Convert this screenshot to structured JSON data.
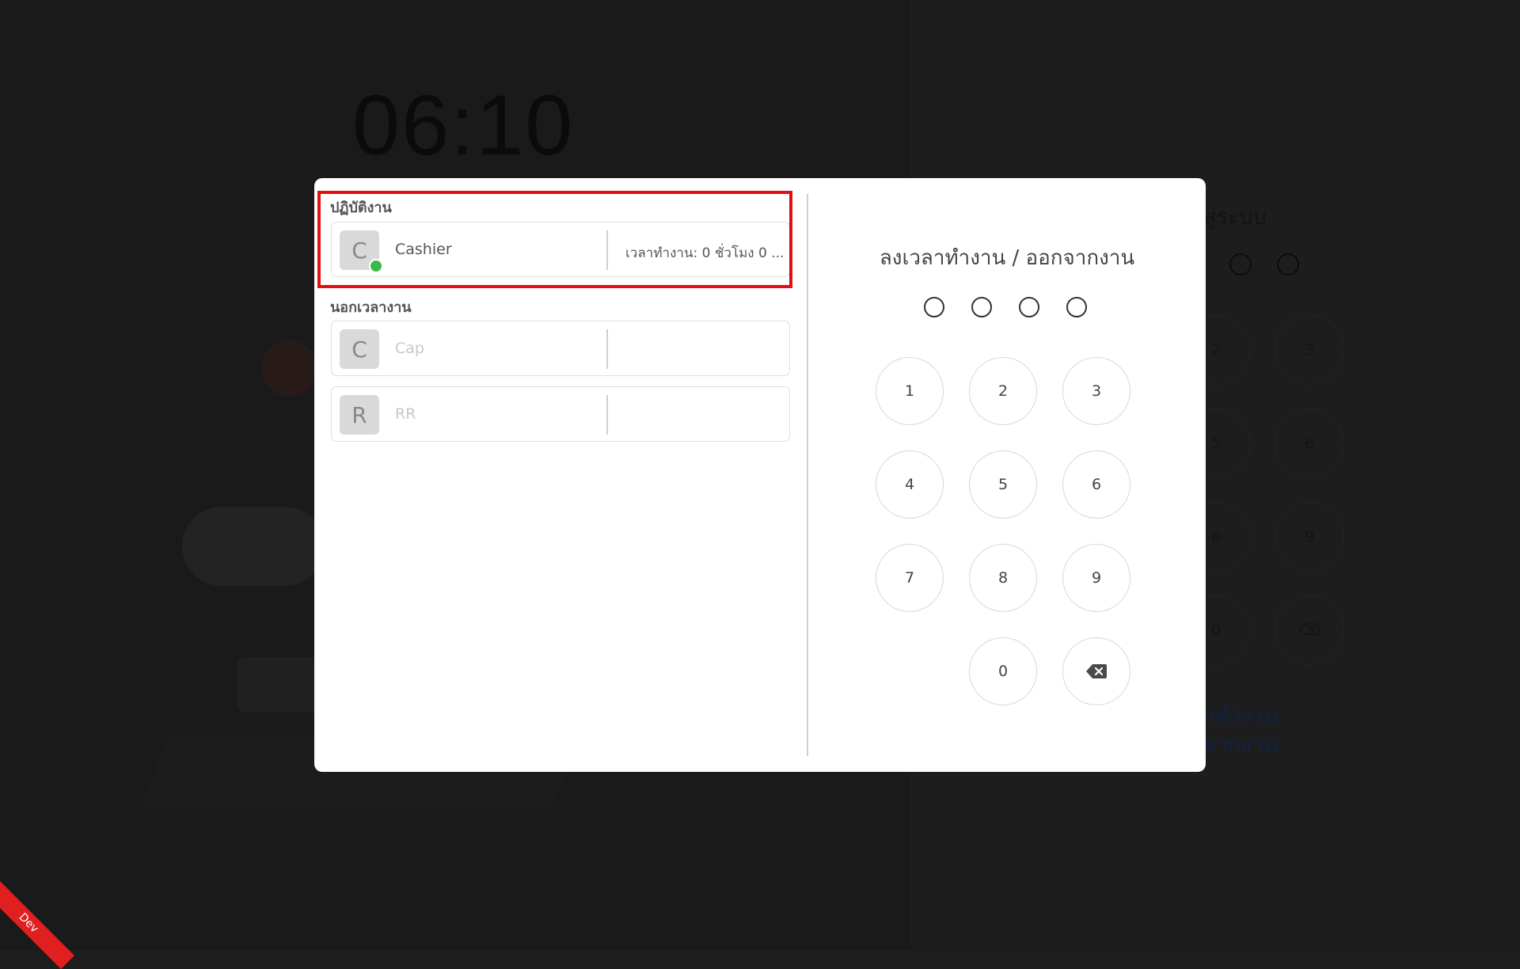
{
  "background": {
    "clock": "06:10",
    "login_title_partial": "สู่ระบบ",
    "keypad": [
      "2",
      "3",
      "5",
      "6",
      "8",
      "9",
      "0"
    ],
    "link_lines": [
      "าทำงาน",
      "จากงาน"
    ]
  },
  "dev_badge": "Dev",
  "modal": {
    "on_duty_label": "ปฏิบัติงาน",
    "off_duty_label": "นอกเวลางาน",
    "on_duty": [
      {
        "initial": "C",
        "name": "Cashier",
        "work_time": "เวลาทำงาน: 0 ชั่วโมง 0 ...",
        "online": true
      }
    ],
    "off_duty": [
      {
        "initial": "C",
        "name": "Cap",
        "work_time": ""
      },
      {
        "initial": "R",
        "name": "RR",
        "work_time": ""
      }
    ],
    "pin_title": "ลงเวลาทำงาน / ออกจากงาน",
    "pin_length": 4,
    "keys": [
      "1",
      "2",
      "3",
      "4",
      "5",
      "6",
      "7",
      "8",
      "9",
      "0"
    ],
    "backspace_icon": "backspace-icon"
  },
  "colors": {
    "highlight_border": "#e01010",
    "status_online": "#3cb84a",
    "dev_ribbon": "#e02020"
  }
}
